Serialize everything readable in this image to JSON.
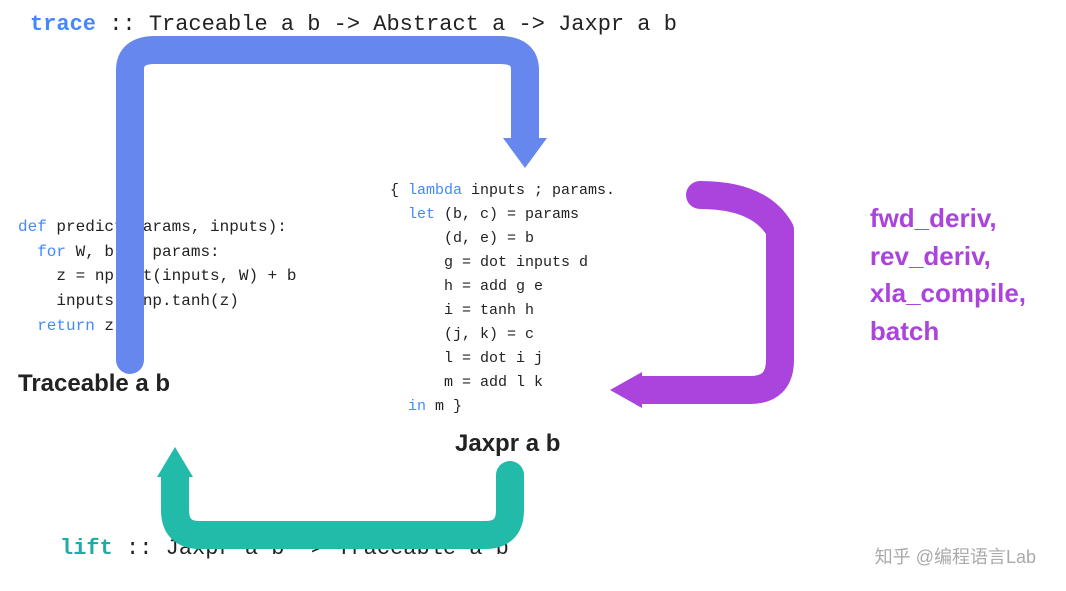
{
  "top_signature": {
    "trace": "trace",
    "rest": " :: Traceable a b -> Abstract a -> Jaxpr a b"
  },
  "python_code": {
    "lines": [
      {
        "parts": [
          {
            "text": "def ",
            "color": "plain"
          },
          {
            "text": "predict",
            "color": "plain"
          },
          {
            "text": "(params, inputs):",
            "color": "plain"
          }
        ]
      },
      {
        "parts": [
          {
            "text": "  for W, b in params:",
            "color": "plain"
          }
        ]
      },
      {
        "parts": [
          {
            "text": "    z = np.dot(inputs, W) + b",
            "color": "plain"
          }
        ]
      },
      {
        "parts": [
          {
            "text": "    inputs = np.tanh(z)",
            "color": "plain"
          }
        ]
      },
      {
        "parts": [
          {
            "text": "  return z",
            "color": "plain"
          }
        ]
      }
    ]
  },
  "traceable_label": "Traceable a b",
  "jaxpr_code": {
    "lines": [
      "{ lambda inputs ; params.",
      "  let (b, c) = params",
      "      (d, e) = b",
      "      g = dot inputs d",
      "      h = add g e",
      "      i = tanh h",
      "      (j, k) = c",
      "      l = dot i j",
      "      m = add l k",
      "  in m }"
    ]
  },
  "jaxpr_label": "Jaxpr a b",
  "right_labels": {
    "lines": [
      "fwd_deriv,",
      "rev_deriv,",
      "xla_compile,",
      "batch"
    ]
  },
  "bottom_signature": {
    "lift": "lift",
    "rest": " :: Jaxpr a b -> Traceable a b"
  },
  "watermark": "知乎 @编程语言Lab",
  "colors": {
    "blue_arrow": "#6688ee",
    "teal_arrow": "#22bbaa",
    "purple_arrow": "#aa44dd",
    "keyword_blue": "#4488ff",
    "keyword_teal": "#22aaaa",
    "code_plain": "#222222",
    "lambda_color": "#4488ff"
  }
}
